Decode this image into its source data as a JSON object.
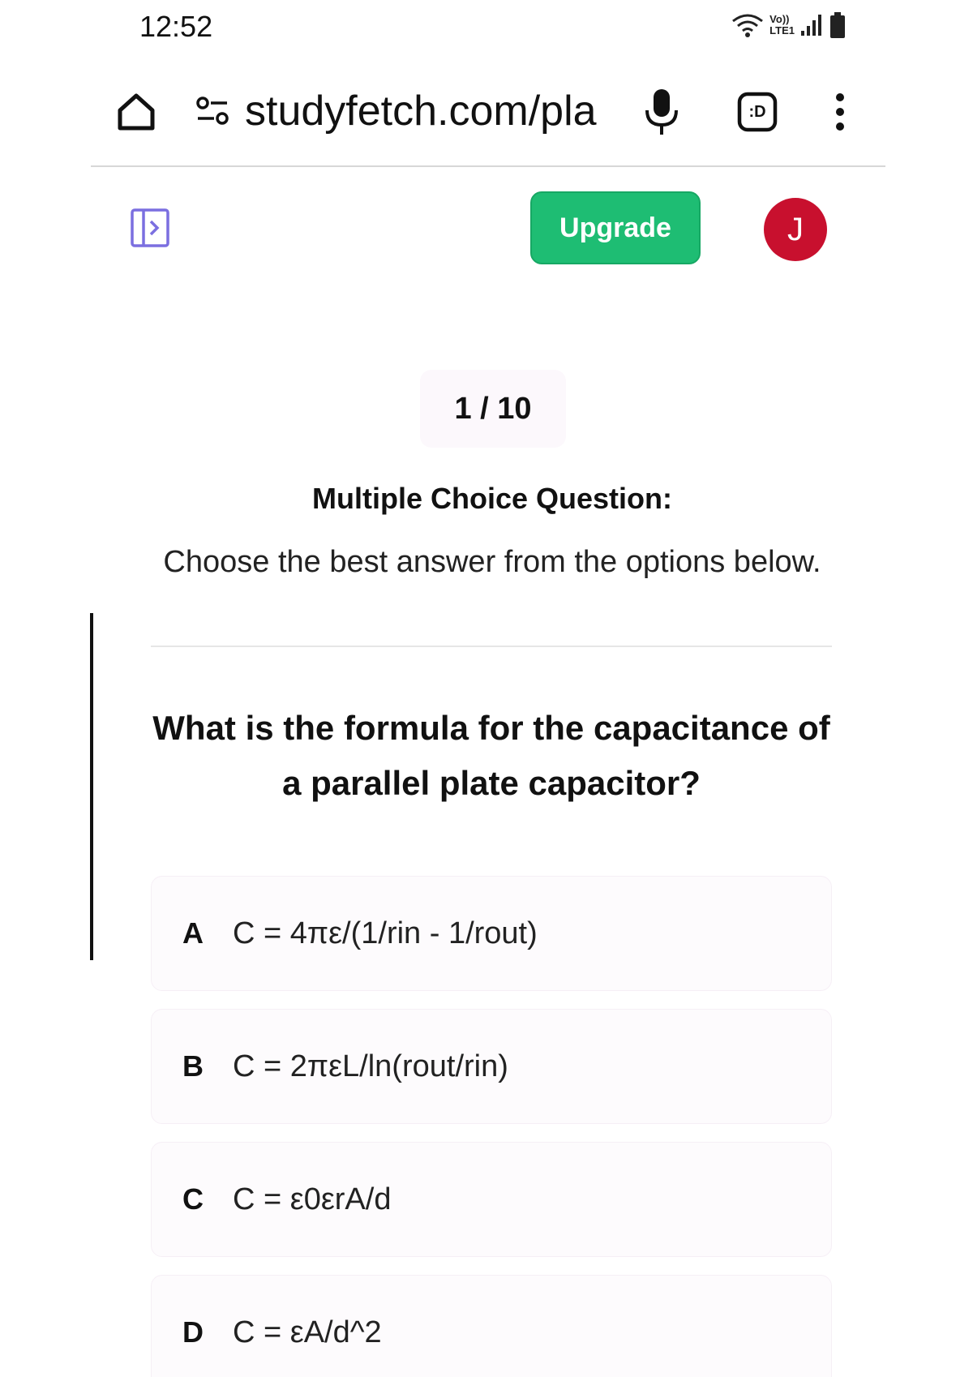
{
  "status_bar": {
    "time": "12:52",
    "network_label_top": "Vo))",
    "network_label_bottom": "LTE1",
    "icons": [
      "wifi-icon",
      "signal-icon",
      "battery-icon"
    ]
  },
  "browser": {
    "url": "studyfetch.com/pla",
    "icons": [
      "home-icon",
      "site-info-icon",
      "mic-icon",
      "tabs-icon",
      "more-vert-icon"
    ],
    "tabs_label": ":D"
  },
  "header": {
    "upgrade_label": "Upgrade",
    "avatar_initial": "J",
    "upgrade_color": "#1ebd73",
    "avatar_color": "#c8102e",
    "sidebar_icon_color": "#7b6fe0"
  },
  "quiz": {
    "counter": "1 / 10",
    "title": "Multiple Choice Question:",
    "instruction": "Choose the best answer from the options below.",
    "question": "What is the formula for the capacitance of a parallel plate capacitor?",
    "options": [
      {
        "letter": "A",
        "text": "C = 4πε/(1/rin - 1/rout)"
      },
      {
        "letter": "B",
        "text": "C = 2πεL/ln(rout/rin)"
      },
      {
        "letter": "C",
        "text": "C = ε0εrA/d"
      },
      {
        "letter": "D",
        "text": "C = εA/d^2"
      }
    ]
  }
}
